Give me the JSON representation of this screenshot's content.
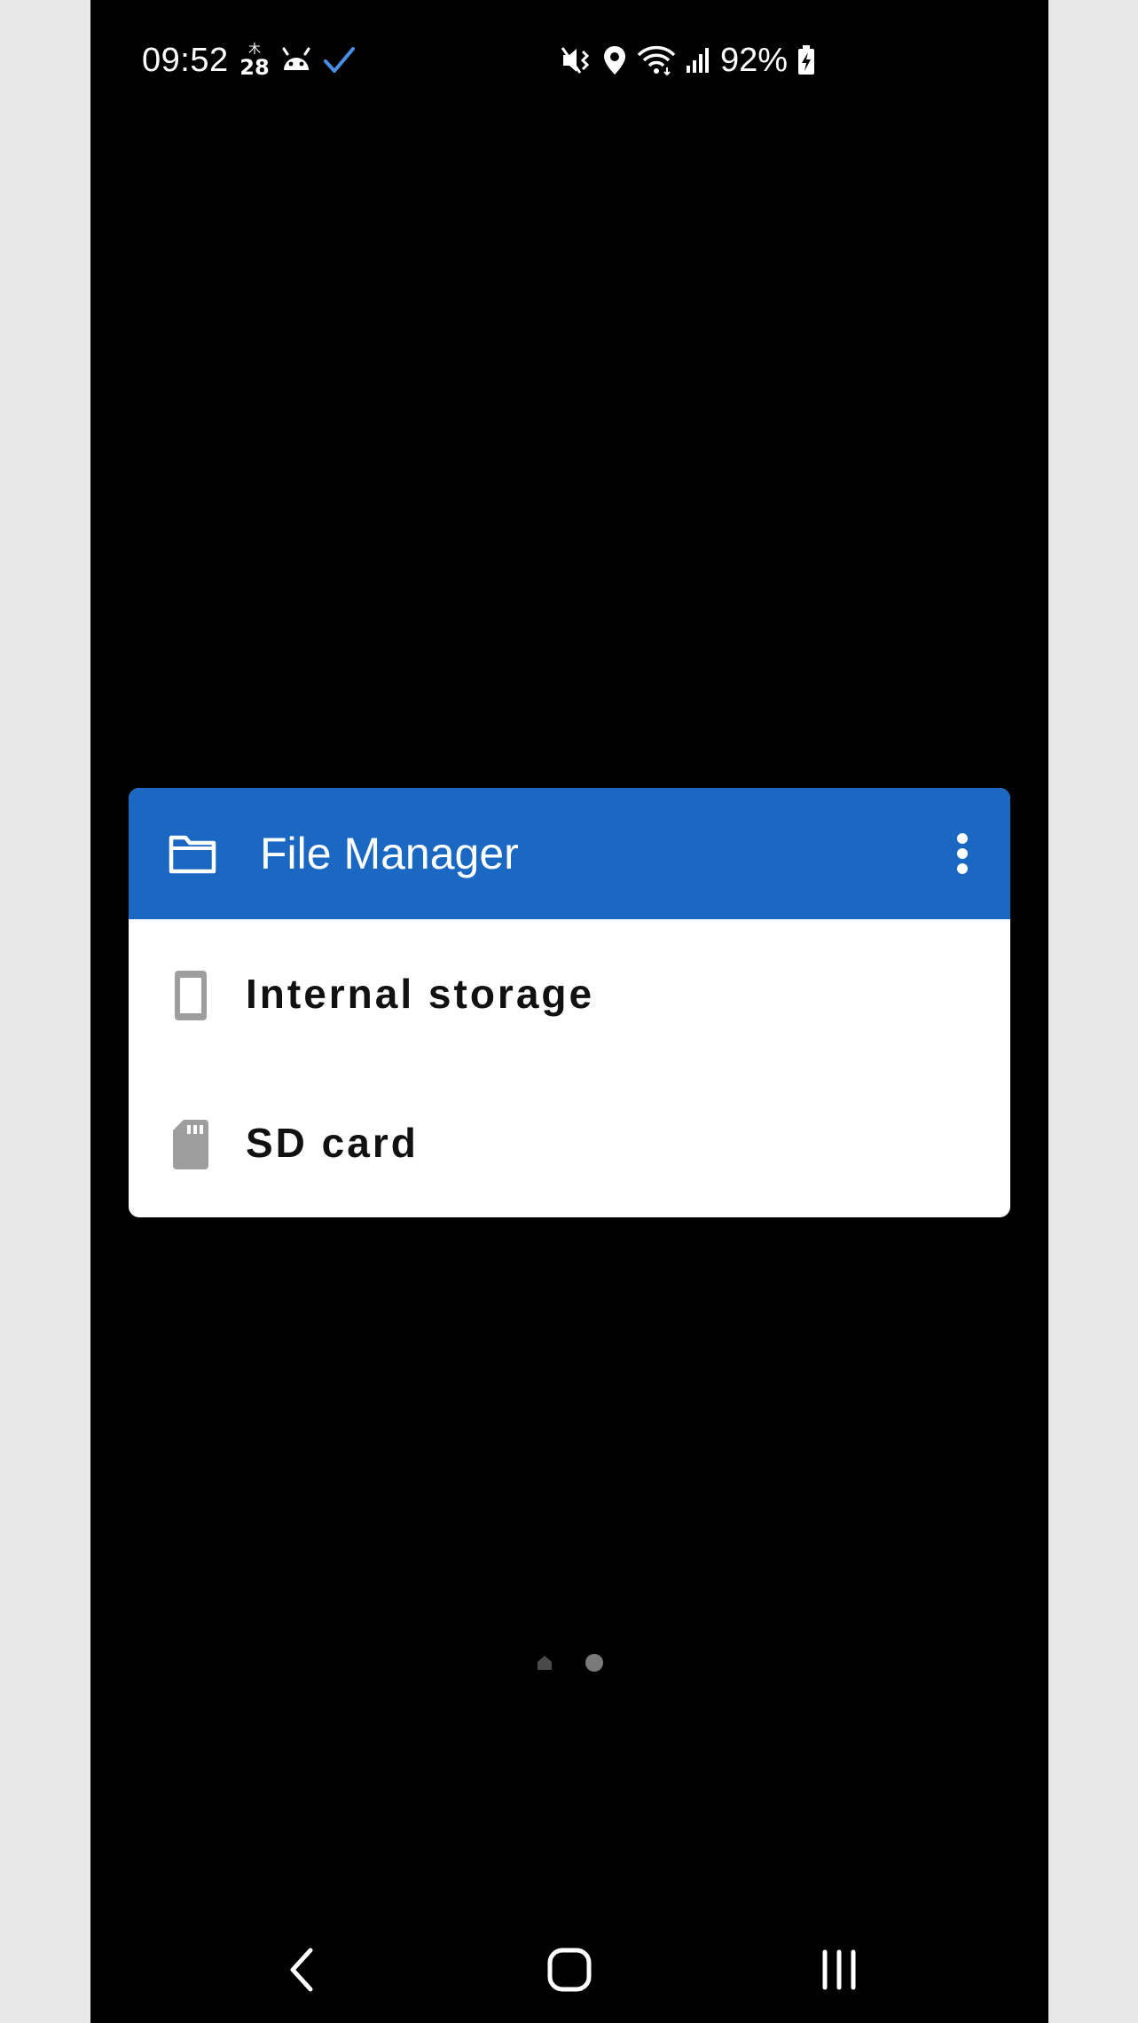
{
  "status_bar": {
    "time": "09:52",
    "calendar_top": "木",
    "calendar_day": "28",
    "battery": "92%",
    "icons": [
      "calendar-icon",
      "android-icon",
      "check-icon",
      "mute-icon",
      "location-icon",
      "wifi-icon",
      "signal-icon",
      "battery-charging-icon"
    ],
    "check_color": "#4a8fe7"
  },
  "widget": {
    "title": "File Manager",
    "header_color": "#1b68c3",
    "header_icon": "folder-icon",
    "menu_icon": "more-vert-icon",
    "items": [
      {
        "label": "Internal storage",
        "icon": "phone-storage-icon"
      },
      {
        "label": "SD card",
        "icon": "sd-card-icon"
      }
    ]
  },
  "page_indicator": {
    "pages": [
      "home",
      "dot"
    ],
    "active": 1
  },
  "nav_bar": {
    "buttons": [
      "back-icon",
      "home-icon",
      "recents-icon"
    ]
  }
}
